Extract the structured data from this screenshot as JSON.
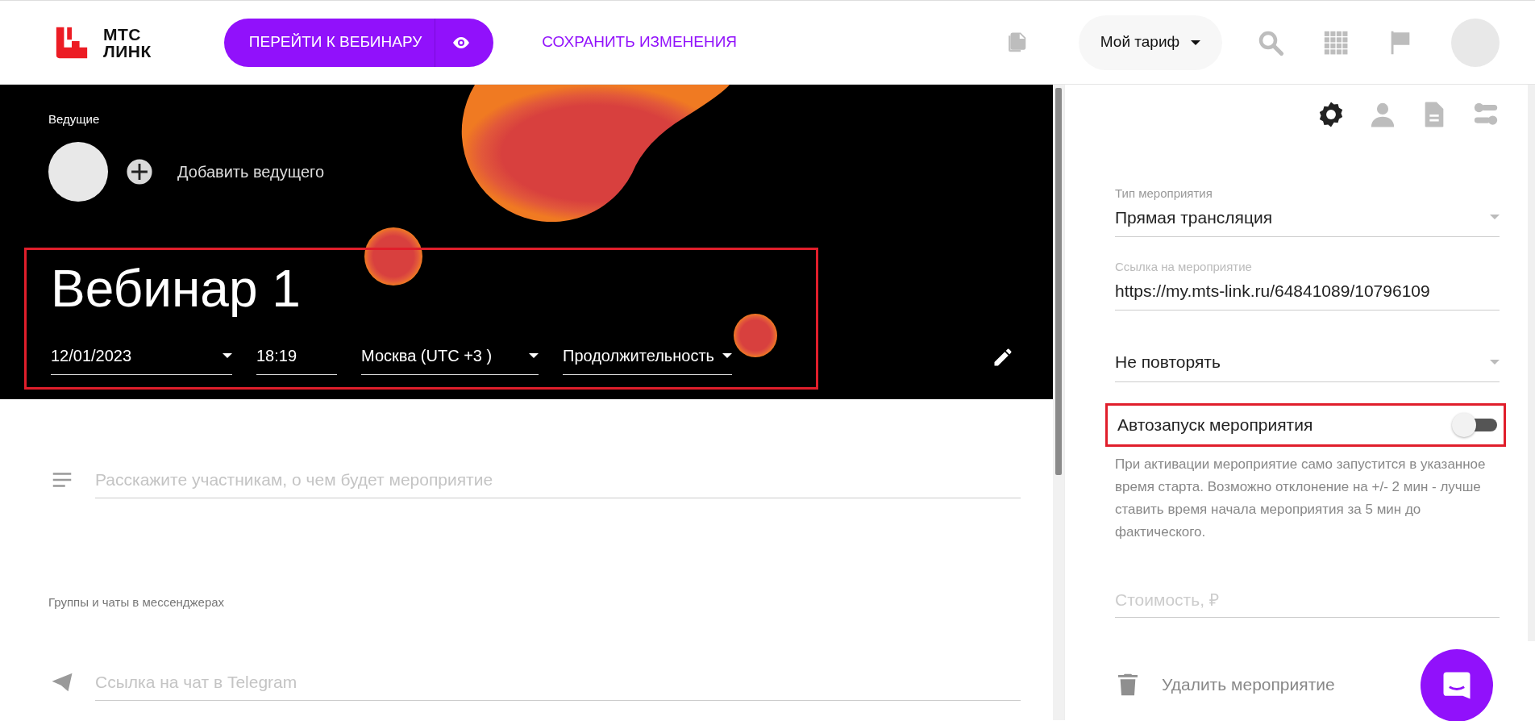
{
  "header": {
    "logo": {
      "line_1": "МТС",
      "line_2": "ЛИНК"
    },
    "primary_button": "ПЕРЕЙТИ К ВЕБИНАРУ",
    "save_link": "СОХРАНИТЬ ИЗМЕНЕНИЯ",
    "plan_button": "Мой тариф"
  },
  "banner": {
    "hosts_label": "Ведущие",
    "add_host": "Добавить ведущего",
    "title": "Вебинар 1",
    "highlighted": true,
    "fields": [
      {
        "kind": "dropdown",
        "value": "12/01/2023"
      },
      {
        "kind": "text",
        "value": "18:19"
      },
      {
        "kind": "dropdown",
        "value": "Москва (UTC +3 )"
      },
      {
        "kind": "dropdown",
        "value": "Продолжительность"
      }
    ]
  },
  "content": {
    "description_placeholder": "Расскажите участникам, о чем будет мероприятие",
    "messengers_label": "Группы и чаты в мессенджерах",
    "telegram_placeholder": "Ссылка на чат в Telegram"
  },
  "settings": {
    "tabs": [
      {
        "selected": true
      },
      {
        "selected": false
      },
      {
        "selected": false
      },
      {
        "selected": false
      }
    ],
    "fields": [
      {
        "kind": "select",
        "label": "Тип мероприятия",
        "value": "Прямая трансляция"
      },
      {
        "kind": "text",
        "label": "Ссылка на мероприятие",
        "value": "https://my.mts-link.ru/64841089/10796109"
      },
      {
        "kind": "select",
        "value": "Не повторять"
      }
    ],
    "autostart": {
      "label": "Автозапуск мероприятия",
      "on": false,
      "highlighted": true,
      "help": "При активации мероприятие само запустится в указанное время старта. Возможно отклонение на +/- 2 мин - лучше ставить время начала мероприятия за 5 мин до фактического."
    },
    "price_placeholder": "Стоимость, ₽",
    "delete_label": "Удалить мероприятие"
  }
}
